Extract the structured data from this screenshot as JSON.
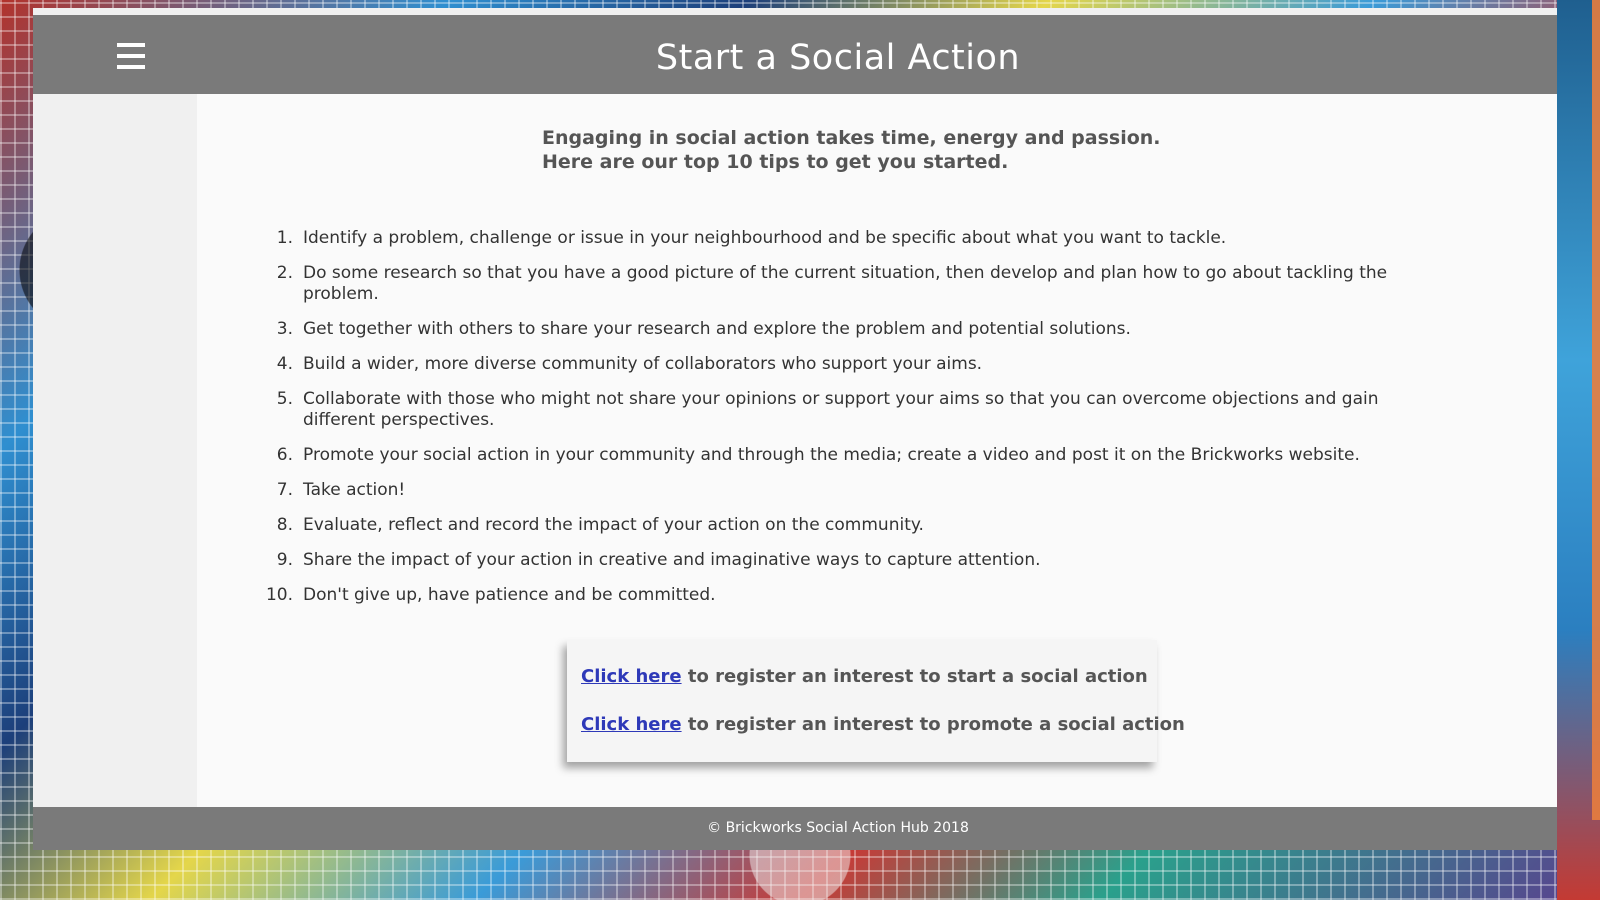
{
  "header": {
    "title": "Start a Social Action",
    "menu_icon": "hamburger-menu-icon"
  },
  "intro": {
    "line1": "Engaging in social action takes time, energy and passion.",
    "line2": "Here are our top 10 tips to get you started."
  },
  "tips": [
    {
      "num": "1.",
      "text": "Identify a problem, challenge or issue in your neighbourhood and be specific about what you want to tackle."
    },
    {
      "num": "2.",
      "text": "Do some research so that you have a good picture of the current situation, then develop and plan how to go about tackling the problem."
    },
    {
      "num": "3.",
      "text": "Get together with others to share your research and explore the problem and potential solutions."
    },
    {
      "num": "4.",
      "text": "Build a wider, more diverse community of collaborators who support your aims."
    },
    {
      "num": "5.",
      "text": "Collaborate with those who might not share your opinions or support your aims so that you can overcome objections and gain different perspectives."
    },
    {
      "num": "6.",
      "text": "Promote your social action in your community and through the media; create a video and post it on the Brickworks website."
    },
    {
      "num": "7.",
      "text": "Take action!"
    },
    {
      "num": "8.",
      "text": "Evaluate, reflect and record the impact of your action on the community."
    },
    {
      "num": "9.",
      "text": "Share the impact of your action in creative and imaginative ways to capture attention."
    },
    {
      "num": "10.",
      "text": "Don't give up, have patience and be committed."
    }
  ],
  "cta": {
    "start": {
      "link": "Click here",
      "text": " to register an interest to start a social action"
    },
    "promote": {
      "link": "Click here",
      "text": " to register an interest to promote a social action"
    }
  },
  "footer": {
    "copyright": "© Brickworks Social Action Hub 2018"
  },
  "colors": {
    "header_bg": "#7a7a7a",
    "link": "#2e39b8",
    "scrollbar": "#e87d3e"
  }
}
